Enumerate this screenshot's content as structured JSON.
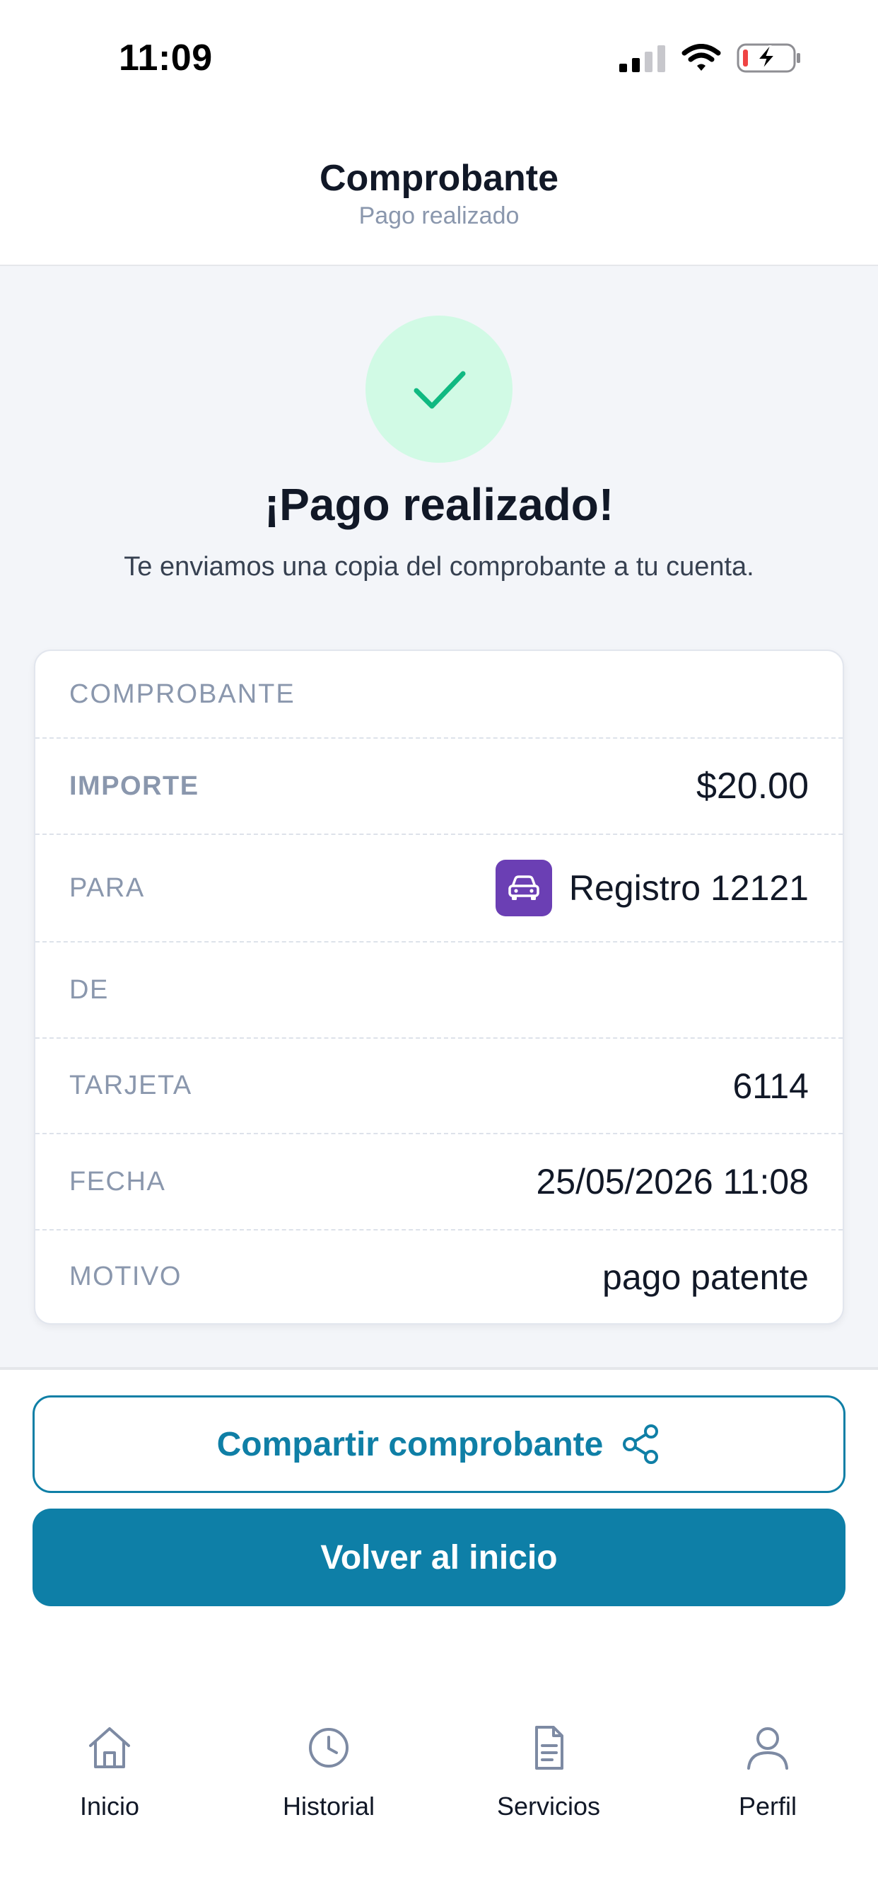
{
  "status_bar": {
    "time": "11:09"
  },
  "header": {
    "title": "Comprobante",
    "subtitle": "Pago realizado"
  },
  "success": {
    "title": "¡Pago realizado!",
    "description": "Te enviamos una copia del comprobante a tu cuenta."
  },
  "receipt": {
    "heading": "COMPROBANTE",
    "rows": [
      {
        "label": "IMPORTE",
        "value": "$20.00"
      },
      {
        "label": "PARA",
        "value": "Registro 12121",
        "icon": "car-icon"
      },
      {
        "label": "DE",
        "value": ""
      },
      {
        "label": "TARJETA",
        "value": "6114"
      },
      {
        "label": "FECHA",
        "value": "25/05/2026 11:08"
      },
      {
        "label": "MOTIVO",
        "value": "pago patente"
      }
    ]
  },
  "actions": {
    "share_label": "Compartir comprobante",
    "home_label": "Volver al inicio"
  },
  "bottom_nav": {
    "items": [
      {
        "label": "Inicio",
        "icon": "home-icon"
      },
      {
        "label": "Historial",
        "icon": "clock-icon"
      },
      {
        "label": "Servicios",
        "icon": "document-icon"
      },
      {
        "label": "Perfil",
        "icon": "user-icon"
      }
    ]
  },
  "colors": {
    "primary": "#0e7fa7",
    "success_bg": "#d1fae5",
    "success_check": "#10b981",
    "car_badge": "#6b3fb4",
    "battery_low": "#ef4444"
  }
}
